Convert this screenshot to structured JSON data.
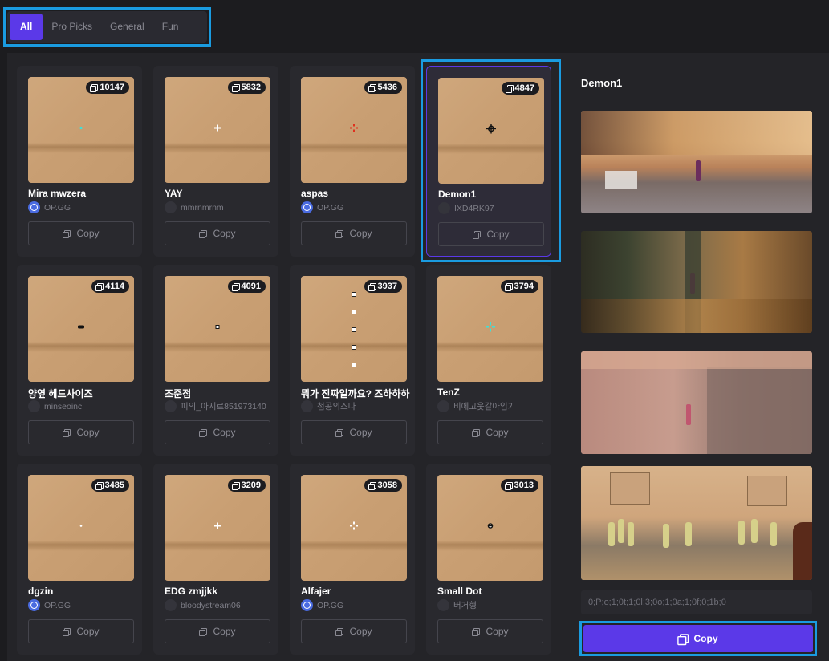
{
  "tabs": [
    {
      "label": "All",
      "active": true
    },
    {
      "label": "Pro Picks",
      "active": false
    },
    {
      "label": "General",
      "active": false
    },
    {
      "label": "Fun",
      "active": false
    }
  ],
  "copy_label": "Copy",
  "cards": [
    {
      "name": "Mira mwzera",
      "author": "OP.GG",
      "author_badge": "opgg",
      "count": "10147",
      "crosshair": "cyan-dot"
    },
    {
      "name": "YAY",
      "author": "mmrnmrnm",
      "author_badge": "none",
      "count": "5832",
      "crosshair": "white-plus"
    },
    {
      "name": "aspas",
      "author": "OP.GG",
      "author_badge": "opgg",
      "count": "5436",
      "crosshair": "red-cross"
    },
    {
      "name": "Demon1",
      "author": "IXD4RK97",
      "author_badge": "none",
      "count": "4847",
      "crosshair": "black-ring",
      "selected": true
    },
    {
      "name": "양옆 헤드사이즈",
      "author": "minseoinc",
      "author_badge": "none",
      "count": "4114",
      "crosshair": "black-bar"
    },
    {
      "name": "조준점",
      "author": "피의_아지르851973140",
      "author_badge": "none",
      "count": "4091",
      "crosshair": "small-box"
    },
    {
      "name": "뭐가 진짜일까요? 즈하하하",
      "author": "첨공의스나",
      "author_badge": "none",
      "count": "3937",
      "crosshair": "box-column"
    },
    {
      "name": "TenZ",
      "author": "비에고웃갈아입기",
      "author_badge": "none",
      "count": "3794",
      "crosshair": "cyan-plus"
    },
    {
      "name": "dgzin",
      "author": "OP.GG",
      "author_badge": "opgg",
      "count": "3485",
      "crosshair": "white-dot"
    },
    {
      "name": "EDG zmjjkk",
      "author": "bloodystream06",
      "author_badge": "none",
      "count": "3209",
      "crosshair": "white-plus"
    },
    {
      "name": "Alfajer",
      "author": "OP.GG",
      "author_badge": "opgg",
      "count": "3058",
      "crosshair": "white-diamond"
    },
    {
      "name": "Small Dot",
      "author": "버거형",
      "author_badge": "none",
      "count": "3013",
      "crosshair": "dark-dot"
    }
  ],
  "detail": {
    "title": "Demon1",
    "code": "0;P;o;1;0t;1;0l;3;0o;1;0a;1;0f;0;1b;0",
    "copy_label": "Copy"
  },
  "colors": {
    "accent": "#5b39e8",
    "highlight": "#1a9be0"
  }
}
